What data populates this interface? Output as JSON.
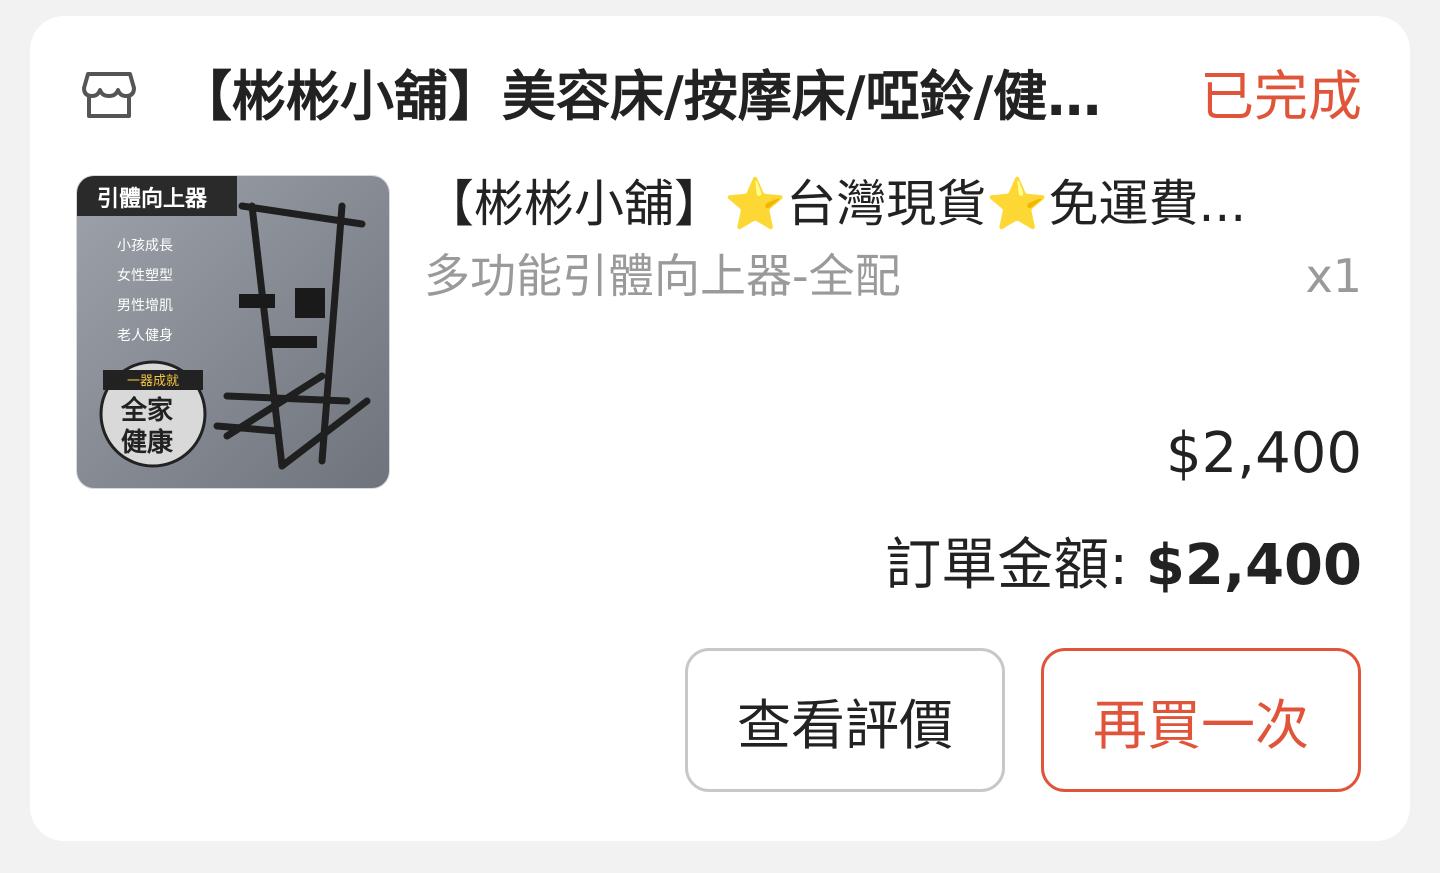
{
  "order": {
    "shop_name": "【彬彬小舖】美容床/按摩床/啞鈴/健身...",
    "status": "已完成",
    "status_color": "#e0553a"
  },
  "product": {
    "title": "【彬彬小舖】⭐台灣現貨⭐免運費...",
    "variant": "多功能引體向上器-全配",
    "quantity": "x1",
    "price": "$2,400",
    "image": {
      "banner": "引體向上器",
      "tags": [
        "小孩成長",
        "女性塑型",
        "男性增肌",
        "老人健身"
      ],
      "badge_top": "一器成就",
      "badge_line1": "全家",
      "badge_line2": "健康"
    }
  },
  "summary": {
    "total_label": "訂單金額: ",
    "total_amount": "$2,400"
  },
  "actions": {
    "review_label": "查看評價",
    "rebuy_label": "再買一次"
  },
  "icons": {
    "shop": "shop-storefront-icon"
  }
}
